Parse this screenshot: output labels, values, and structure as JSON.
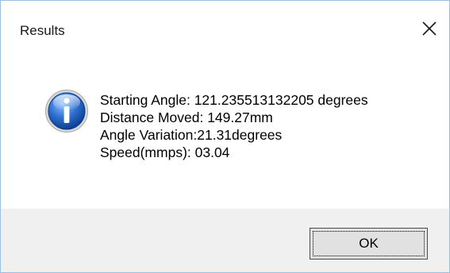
{
  "window": {
    "title": "Results",
    "close_icon": "close-icon"
  },
  "message": {
    "icon": "info-icon",
    "lines": [
      "Starting Angle: 121.235513132205 degrees",
      "Distance Moved: 149.27mm",
      "Angle Variation:21.31degrees",
      "Speed(mmps): 03.04"
    ]
  },
  "buttons": {
    "ok_label": "OK"
  },
  "colors": {
    "border": "#9bbfe0",
    "footer_bg": "#f0f0f0",
    "icon_blue": "#1f5fb8"
  }
}
